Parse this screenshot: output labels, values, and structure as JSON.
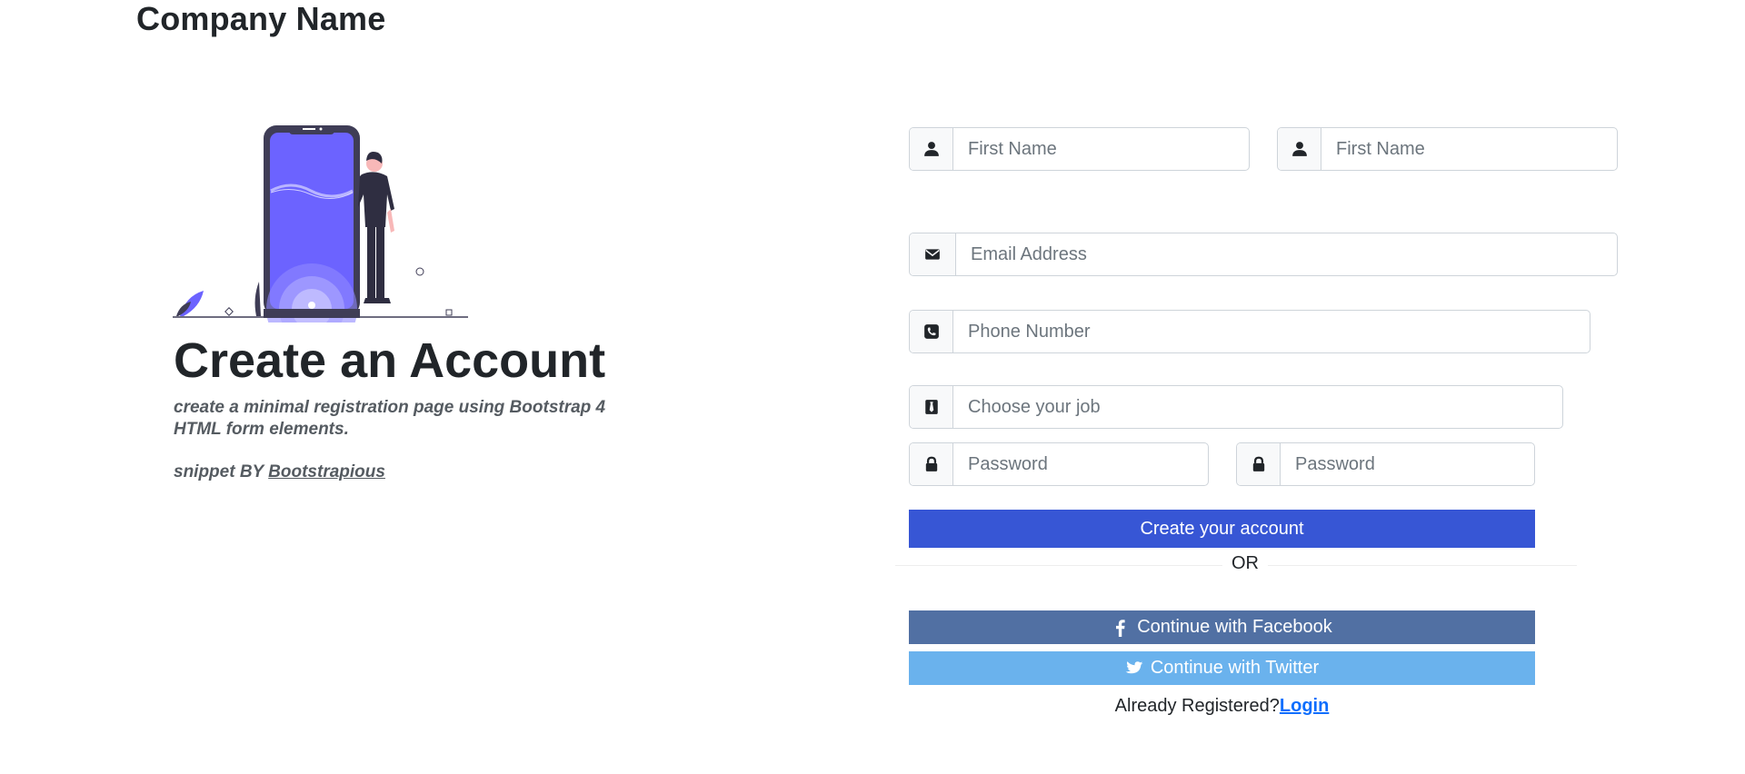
{
  "brand": {
    "name": "Company Name"
  },
  "hero": {
    "title": "Create an Account",
    "subtitle": "create a minimal registration page using Bootstrap 4 HTML form elements.",
    "snippet_prefix": "snippet BY ",
    "snippet_link": "Bootstrapious"
  },
  "form": {
    "first_name": {
      "placeholder": "First Name",
      "icon": "user-icon"
    },
    "last_name": {
      "placeholder": "First Name",
      "icon": "user-icon"
    },
    "email": {
      "placeholder": "Email Address",
      "icon": "envelope-icon"
    },
    "phone": {
      "placeholder": "Phone Number",
      "icon": "phone-icon"
    },
    "job": {
      "placeholder": "Choose your job",
      "icon": "tie-icon"
    },
    "password": {
      "placeholder": "Password",
      "icon": "lock-icon"
    },
    "password_confirm": {
      "placeholder": "Password",
      "icon": "lock-icon"
    },
    "submit_label": "Create your account",
    "or_label": "OR",
    "facebook_label": "Continue with Facebook",
    "twitter_label": "Continue with Twitter",
    "already_registered": "Already Registered?",
    "login_label": "Login"
  },
  "colors": {
    "primary": "#3756d5",
    "facebook": "#5170a3",
    "twitter": "#6ab2ed",
    "illustration_accent": "#6c63ff"
  }
}
